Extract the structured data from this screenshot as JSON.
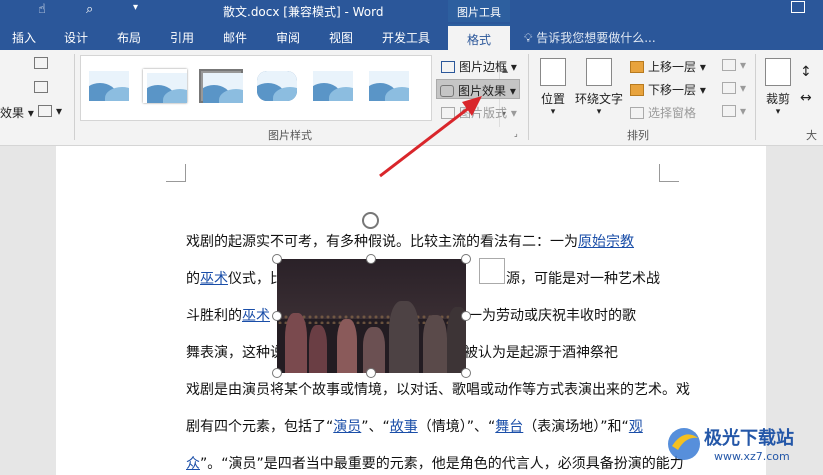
{
  "titlebar": {
    "title": "散文.docx [兼容模式] - Word",
    "context_tab": "图片工具"
  },
  "tabs": [
    "插入",
    "设计",
    "布局",
    "引用",
    "邮件",
    "审阅",
    "视图",
    "开发工具"
  ],
  "active_tab": "格式",
  "tellme": "告诉我您想要做什么...",
  "ribbon": {
    "left_label": "效果",
    "group_styles": "图片样式",
    "border": "图片边框",
    "effects": "图片效果",
    "layout": "图片版式",
    "position": "位置",
    "wrap": "环绕文字",
    "bring_forward": "上移一层",
    "send_backward": "下移一层",
    "selection_pane": "选择窗格",
    "group_arrange": "排列",
    "crop": "裁剪",
    "size_partial": "大"
  },
  "document": {
    "line1a": "戏剧的起源实不可考，有多种假说。比较主流的看法有二：一为",
    "line1b": "原始宗教",
    "line2a": "的",
    "line2b": "巫术",
    "line2c": "仪式，比",
    "line2d": "源，可能是对一种艺术战",
    "line3a": "斗胜利的",
    "line3b": "巫术",
    "line3c": "一为劳动或庆祝丰收时的歌",
    "line4a": "舞表演，这种说",
    "line4b": "被认为是起源于酒神祭祀",
    "line5": "戏剧是由演员将某个故事或情境，以对话、歌唱或动作等方式表演出来的艺术。戏",
    "line6a": "剧有四个元素，包括了“",
    "line6b": "演员",
    "line6c": "”、“",
    "line6d": "故事",
    "line6e": "（情境）”、“",
    "line6f": "舞台",
    "line6g": "（表演场地）”和“",
    "line6h": "观",
    "line7a": "众",
    "line7b": "”。“演员”是四者当中最重要的元素，他是角色的代言人，必须具备扮演的能力"
  },
  "watermark": {
    "text": "极光下载站",
    "url": "www.xz7.com"
  },
  "colors": {
    "accent": "#2b579a",
    "arrow": "#d9262b",
    "link": "#1a4ea8"
  }
}
